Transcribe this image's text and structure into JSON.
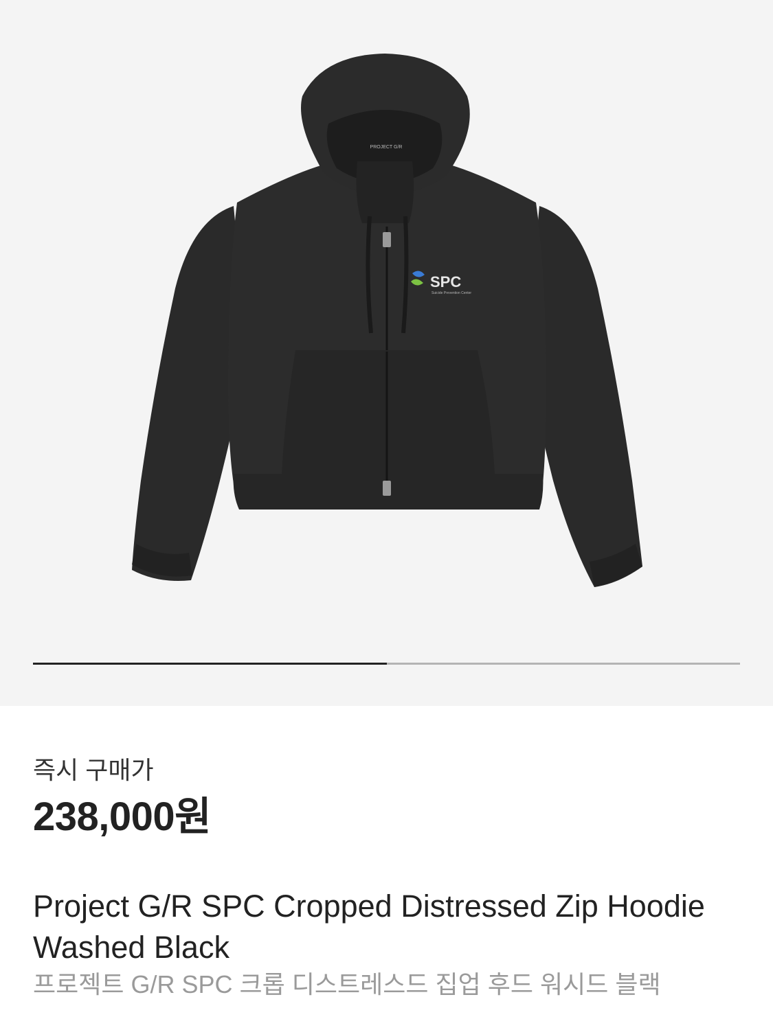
{
  "gallery": {
    "image_alt": "Project G/R SPC Cropped Distressed Zip Hoodie Washed Black",
    "hood_label": "PROJECT G/R",
    "logo_text": "SPC",
    "logo_subtext": "Suicide Prevention Center",
    "progress": 0.5,
    "colors": {
      "background": "#f4f4f4",
      "progress_fill": "#222222",
      "progress_track": "#b4b4b4"
    }
  },
  "product": {
    "price_label": "즉시 구매가",
    "price": "238,000원",
    "title_en": "Project G/R SPC Cropped Distressed Zip Hoodie Washed Black",
    "title_ko": "프로젝트 G/R SPC 크롭 디스트레스드 집업 후드 워시드 블랙"
  }
}
